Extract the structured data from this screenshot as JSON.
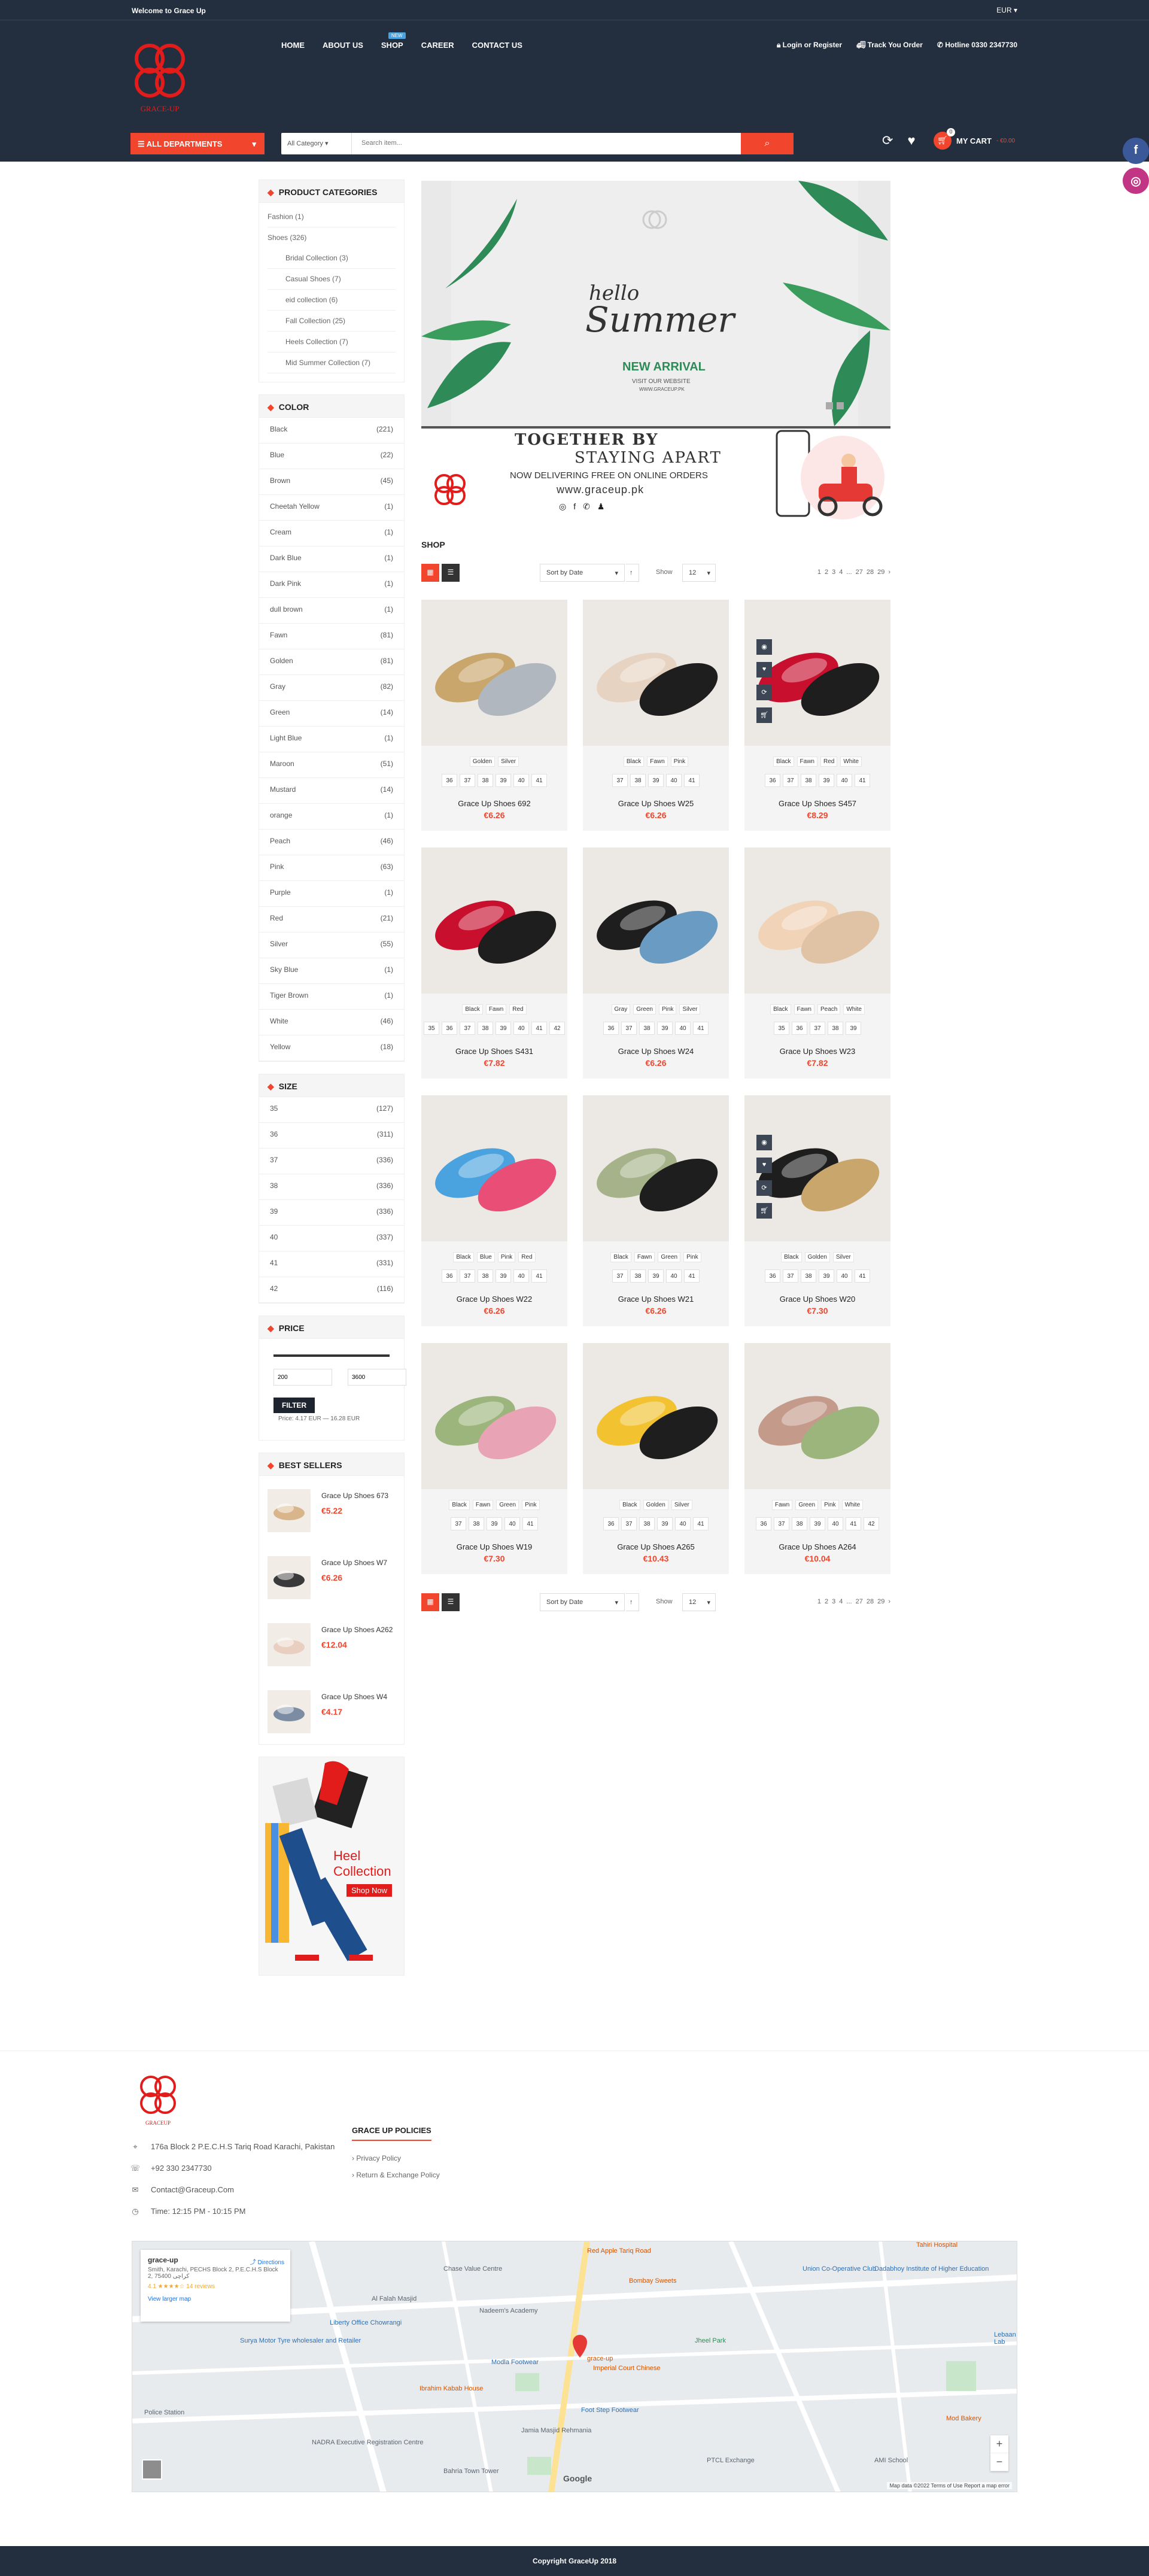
{
  "topbar": {
    "welcome": "Welcome to Grace Up",
    "currency": "EUR"
  },
  "nav": [
    {
      "label": "HOME"
    },
    {
      "label": "ABOUT US"
    },
    {
      "label": "SHOP",
      "badge": "NEW"
    },
    {
      "label": "CAREER"
    },
    {
      "label": "CONTACT US"
    }
  ],
  "header_links": {
    "login": "Login or Register",
    "track": "Track You Order",
    "hotline": "Hotline 0330 2347730"
  },
  "logo_text": "GRACE-UP",
  "departments": "ALL DEPARTMENTS",
  "search": {
    "category": "All Category",
    "placeholder": "Search item..."
  },
  "cart": {
    "label": "MY CART",
    "value": "- €0.00",
    "count": "0"
  },
  "categories": {
    "title": "PRODUCT CATEGORIES",
    "top": [
      "Fashion (1)",
      "Shoes (326)"
    ],
    "sub": [
      "Bridal Collection (3)",
      "Casual Shoes (7)",
      "eid collection (6)",
      "Fall Collection (25)",
      "Heels Collection (7)",
      "Mid Summer Collection (7)"
    ]
  },
  "color_filter": {
    "title": "COLOR",
    "items": [
      {
        "name": "Black",
        "count": "(221)"
      },
      {
        "name": "Blue",
        "count": "(22)"
      },
      {
        "name": "Brown",
        "count": "(45)"
      },
      {
        "name": "Cheetah Yellow",
        "count": "(1)"
      },
      {
        "name": "Cream",
        "count": "(1)"
      },
      {
        "name": "Dark Blue",
        "count": "(1)"
      },
      {
        "name": "Dark Pink",
        "count": "(1)"
      },
      {
        "name": "dull brown",
        "count": "(1)"
      },
      {
        "name": "Fawn",
        "count": "(81)"
      },
      {
        "name": "Golden",
        "count": "(81)"
      },
      {
        "name": "Gray",
        "count": "(82)"
      },
      {
        "name": "Green",
        "count": "(14)"
      },
      {
        "name": "Light Blue",
        "count": "(1)"
      },
      {
        "name": "Maroon",
        "count": "(51)"
      },
      {
        "name": "Mustard",
        "count": "(14)"
      },
      {
        "name": "orange",
        "count": "(1)"
      },
      {
        "name": "Peach",
        "count": "(46)"
      },
      {
        "name": "Pink",
        "count": "(63)"
      },
      {
        "name": "Purple",
        "count": "(1)"
      },
      {
        "name": "Red",
        "count": "(21)"
      },
      {
        "name": "Silver",
        "count": "(55)"
      },
      {
        "name": "Sky Blue",
        "count": "(1)"
      },
      {
        "name": "Tiger Brown",
        "count": "(1)"
      },
      {
        "name": "White",
        "count": "(46)"
      },
      {
        "name": "Yellow",
        "count": "(18)"
      }
    ]
  },
  "size_filter": {
    "title": "SIZE",
    "items": [
      {
        "name": "35",
        "count": "(127)"
      },
      {
        "name": "36",
        "count": "(311)"
      },
      {
        "name": "37",
        "count": "(336)"
      },
      {
        "name": "38",
        "count": "(336)"
      },
      {
        "name": "39",
        "count": "(336)"
      },
      {
        "name": "40",
        "count": "(337)"
      },
      {
        "name": "41",
        "count": "(331)"
      },
      {
        "name": "42",
        "count": "(116)"
      }
    ]
  },
  "price_filter": {
    "title": "PRICE",
    "min": "200",
    "max": "3600",
    "button": "FILTER",
    "text": "Price: 4.17 EUR — 16.28 EUR"
  },
  "best_sellers": {
    "title": "BEST SELLERS",
    "items": [
      {
        "name": "Grace Up Shoes 673",
        "price": "€5.22"
      },
      {
        "name": "Grace Up Shoes W7",
        "price": "€6.26"
      },
      {
        "name": "Grace Up Shoes A262",
        "price": "€12.04"
      },
      {
        "name": "Grace Up Shoes W4",
        "price": "€4.17"
      }
    ]
  },
  "side_banner": {
    "line1": "Heel",
    "line2": "Collection",
    "cta": "Shop Now"
  },
  "hero": {
    "hello": "hello",
    "summer": "Summer",
    "arrival": "NEW ARRIVAL",
    "visit": "VISIT OUR WEBSITE",
    "site": "WWW.GRACEUP.PK"
  },
  "hero2": {
    "line1": "TOGETHER BY",
    "line2": "STAYING APART",
    "line3": "NOW DELIVERING FREE ON ONLINE ORDERS",
    "site": "www.graceup.pk"
  },
  "shop": {
    "title": "SHOP",
    "sort": "Sort by Date",
    "show_label": "Show",
    "show_value": "12",
    "pages": [
      "1",
      "2",
      "3",
      "4",
      "...",
      "27",
      "28",
      "29",
      "›"
    ]
  },
  "products": [
    {
      "name": "Grace Up Shoes 692",
      "price": "€6.26",
      "colors": [
        "Golden",
        "Silver"
      ],
      "sizes": [
        "36",
        "37",
        "38",
        "39",
        "40",
        "41"
      ]
    },
    {
      "name": "Grace Up Shoes W25",
      "price": "€6.26",
      "colors": [
        "Black",
        "Fawn",
        "Pink"
      ],
      "sizes": [
        "37",
        "38",
        "39",
        "40",
        "41"
      ]
    },
    {
      "name": "Grace Up Shoes S457",
      "price": "€8.29",
      "colors": [
        "Black",
        "Fawn",
        "Red",
        "White"
      ],
      "sizes": [
        "36",
        "37",
        "38",
        "39",
        "40",
        "41"
      ]
    },
    {
      "name": "Grace Up Shoes S431",
      "price": "€7.82",
      "colors": [
        "Black",
        "Fawn",
        "Red"
      ],
      "sizes": [
        "35",
        "36",
        "37",
        "38",
        "39",
        "40",
        "41",
        "42"
      ]
    },
    {
      "name": "Grace Up Shoes W24",
      "price": "€6.26",
      "colors": [
        "Gray",
        "Green",
        "Pink",
        "Silver"
      ],
      "sizes": [
        "36",
        "37",
        "38",
        "39",
        "40",
        "41"
      ]
    },
    {
      "name": "Grace Up Shoes W23",
      "price": "€7.82",
      "colors": [
        "Black",
        "Fawn",
        "Peach",
        "White"
      ],
      "sizes": [
        "35",
        "36",
        "37",
        "38",
        "39"
      ]
    },
    {
      "name": "Grace Up Shoes W22",
      "price": "€6.26",
      "colors": [
        "Black",
        "Blue",
        "Pink",
        "Red"
      ],
      "sizes": [
        "36",
        "37",
        "38",
        "39",
        "40",
        "41"
      ]
    },
    {
      "name": "Grace Up Shoes W21",
      "price": "€6.26",
      "colors": [
        "Black",
        "Fawn",
        "Green",
        "Pink"
      ],
      "sizes": [
        "37",
        "38",
        "39",
        "40",
        "41"
      ]
    },
    {
      "name": "Grace Up Shoes W20",
      "price": "€7.30",
      "colors": [
        "Black",
        "Golden",
        "Silver"
      ],
      "sizes": [
        "36",
        "37",
        "38",
        "39",
        "40",
        "41"
      ]
    },
    {
      "name": "Grace Up Shoes W19",
      "price": "€7.30",
      "colors": [
        "Black",
        "Fawn",
        "Green",
        "Pink"
      ],
      "sizes": [
        "37",
        "38",
        "39",
        "40",
        "41"
      ]
    },
    {
      "name": "Grace Up Shoes A265",
      "price": "€10.43",
      "colors": [
        "Black",
        "Golden",
        "Silver"
      ],
      "sizes": [
        "36",
        "37",
        "38",
        "39",
        "40",
        "41"
      ]
    },
    {
      "name": "Grace Up Shoes A264",
      "price": "€10.04",
      "colors": [
        "Fawn",
        "Green",
        "Pink",
        "White"
      ],
      "sizes": [
        "36",
        "37",
        "38",
        "39",
        "40",
        "41",
        "42"
      ]
    }
  ],
  "footer": {
    "logo_text": "GRACEUP",
    "address": "176a Block 2 P.E.C.H.S Tariq Road Karachi, Pakistan",
    "phone": "+92 330 2347730",
    "email": "Contact@Graceup.Com",
    "time": "Time: 12:15 PM - 10:15 PM",
    "policy_title": "GRACE UP POLICIES",
    "policies": [
      "Privacy Policy",
      "Return & Exchange Policy"
    ]
  },
  "map": {
    "card_title": "grace-up",
    "card_address": "Smith, Karachi, PECHS Block 2, P.E.C.H.S Block 2, کراچی 75400",
    "rating": "4.1 ★★★★☆ 14 reviews",
    "directions": "Directions",
    "larger": "View larger map",
    "labels": [
      "Red Apple Tariq Road",
      "Chase Value Centre",
      "Bombay Sweets",
      "Union Co-Operative Club",
      "Dadabhoy Institute of Higher Education",
      "Tahiri Hospital",
      "Al Falah Masjid",
      "Nadeem's Academy",
      "Liberty Office Chowrangi",
      "Surya Motor Tyre wholesaler and Retailer",
      "Modla Footwear",
      "grace-up",
      "Imperial Court Chinese",
      "Jheel Park",
      "Ibrahim Kabab House",
      "Foot Step Footwear",
      "NADRA Executive Registration Centre",
      "Jamia Masjid Rehmania",
      "Bahria Town Tower",
      "PTCL Exchange",
      "Police Station",
      "AMI School",
      "Mod Bakery",
      "Lebaan Lab"
    ],
    "attribution": "Map data ©2022   Terms of Use   Report a map error",
    "google": "Google"
  },
  "copyright": "Copyright  GraceUp 2018",
  "colors": {
    "dark": "#232f3e",
    "accent": "#f1452d"
  }
}
